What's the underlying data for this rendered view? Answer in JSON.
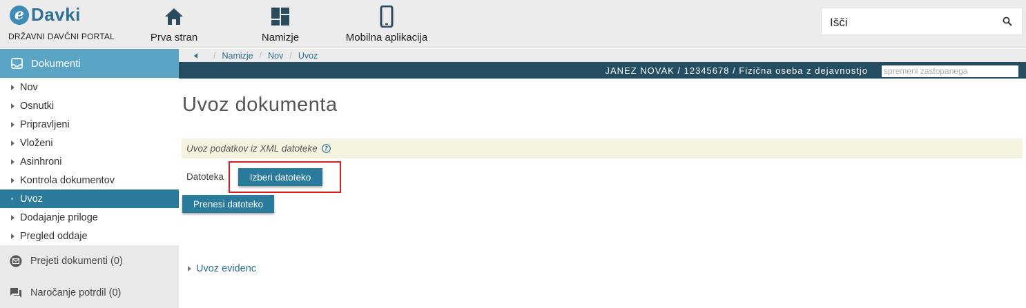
{
  "brand": {
    "logo_letter": "e",
    "name": "Davki",
    "subtitle": "DRŽAVNI DAVČNI PORTAL"
  },
  "nav": [
    {
      "label": "Prva stran",
      "icon": "home-icon"
    },
    {
      "label": "Namizje",
      "icon": "dashboard-icon"
    },
    {
      "label": "Mobilna aplikacija",
      "icon": "smartphone-icon"
    }
  ],
  "search": {
    "placeholder": "Išči",
    "icon": "search-icon"
  },
  "sidebar": {
    "header": {
      "label": "Dokumenti",
      "icon": "inbox-icon"
    },
    "items": [
      {
        "label": "Nov"
      },
      {
        "label": "Osnutki"
      },
      {
        "label": "Pripravljeni"
      },
      {
        "label": "Vloženi"
      },
      {
        "label": "Asinhroni"
      },
      {
        "label": "Kontrola dokumentov"
      },
      {
        "label": "Uvoz",
        "active": true
      },
      {
        "label": "Dodajanje priloge"
      },
      {
        "label": "Pregled oddaje"
      }
    ],
    "extra": [
      {
        "label": "Prejeti dokumenti (0)",
        "icon": "mail-icon"
      },
      {
        "label": "Naročanje potrdil (0)",
        "icon": "chat-icon"
      }
    ]
  },
  "breadcrumb": [
    "Namizje",
    "Nov",
    "Uvoz"
  ],
  "userbar": {
    "identity": "JANEZ NOVAK / 12345678 / Fizična oseba z dejavnostjo",
    "change_rep_placeholder": "spremeni zastopanega"
  },
  "main": {
    "title": "Uvoz dokumenta",
    "info_text": "Uvoz podatkov iz XML datoteke",
    "file_label": "Datoteka",
    "choose_button": "Izberi datoteko",
    "upload_button": "Prenesi datoteko",
    "evidence_link": "Uvoz evidenc"
  },
  "colors": {
    "accent": "#2a7b9b",
    "sidebar_header": "#5aa5c6",
    "userbar": "#254e63",
    "highlight": "#d81e1e",
    "info_bg": "#f5f3df"
  }
}
